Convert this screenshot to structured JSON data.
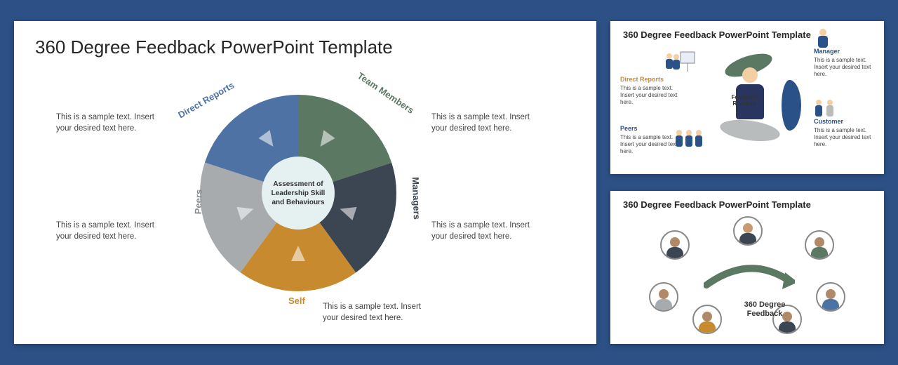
{
  "main": {
    "title": "360 Degree Feedback PowerPoint Template",
    "center_label": "Assessment of Leadership Skill and Behaviours",
    "segments": [
      {
        "name": "Team Members",
        "color": "#5b7863",
        "text": "This is a sample text. Insert your desired text here."
      },
      {
        "name": "Managers",
        "color": "#3c4652",
        "text": "This is a sample text. Insert your desired text here."
      },
      {
        "name": "Self",
        "color": "#c88a2f",
        "text": "This is a sample text. Insert your desired text here."
      },
      {
        "name": "Peers",
        "color": "#a8abae",
        "text": "This is a sample text. Insert your desired text here."
      },
      {
        "name": "Direct Reports",
        "color": "#4e72a4",
        "text": "This is a sample text. Insert your desired text here."
      }
    ]
  },
  "thumb1": {
    "title": "360 Degree Feedback PowerPoint Template",
    "center_label": "Feedback Receiver",
    "groups": [
      {
        "name": "Manager",
        "color": "#2a5188",
        "text": "This is a sample text. Insert your desired text here."
      },
      {
        "name": "Customer",
        "color": "#2a5188",
        "text": "This is a sample text. Insert your desired text here."
      },
      {
        "name": "Peers",
        "color": "#2a5188",
        "text": "This is a sample text. Insert your desired text here."
      },
      {
        "name": "Direct Reports",
        "color": "#c88a2f",
        "text": "This is a sample text. Insert your desired text here."
      }
    ]
  },
  "thumb2": {
    "title": "360 Degree Feedback PowerPoint Template",
    "caption": "360 Degree Feedback"
  },
  "chart_data": {
    "type": "pie",
    "title": "360 Degree Feedback — Assessment of Leadership Skill and Behaviours",
    "categories": [
      "Team Members",
      "Managers",
      "Self",
      "Peers",
      "Direct Reports"
    ],
    "values": [
      20,
      20,
      20,
      20,
      20
    ],
    "series_colors": [
      "#5b7863",
      "#3c4652",
      "#c88a2f",
      "#a8abae",
      "#4e72a4"
    ],
    "annotations": [
      "This is a sample text. Insert your desired text here."
    ]
  }
}
